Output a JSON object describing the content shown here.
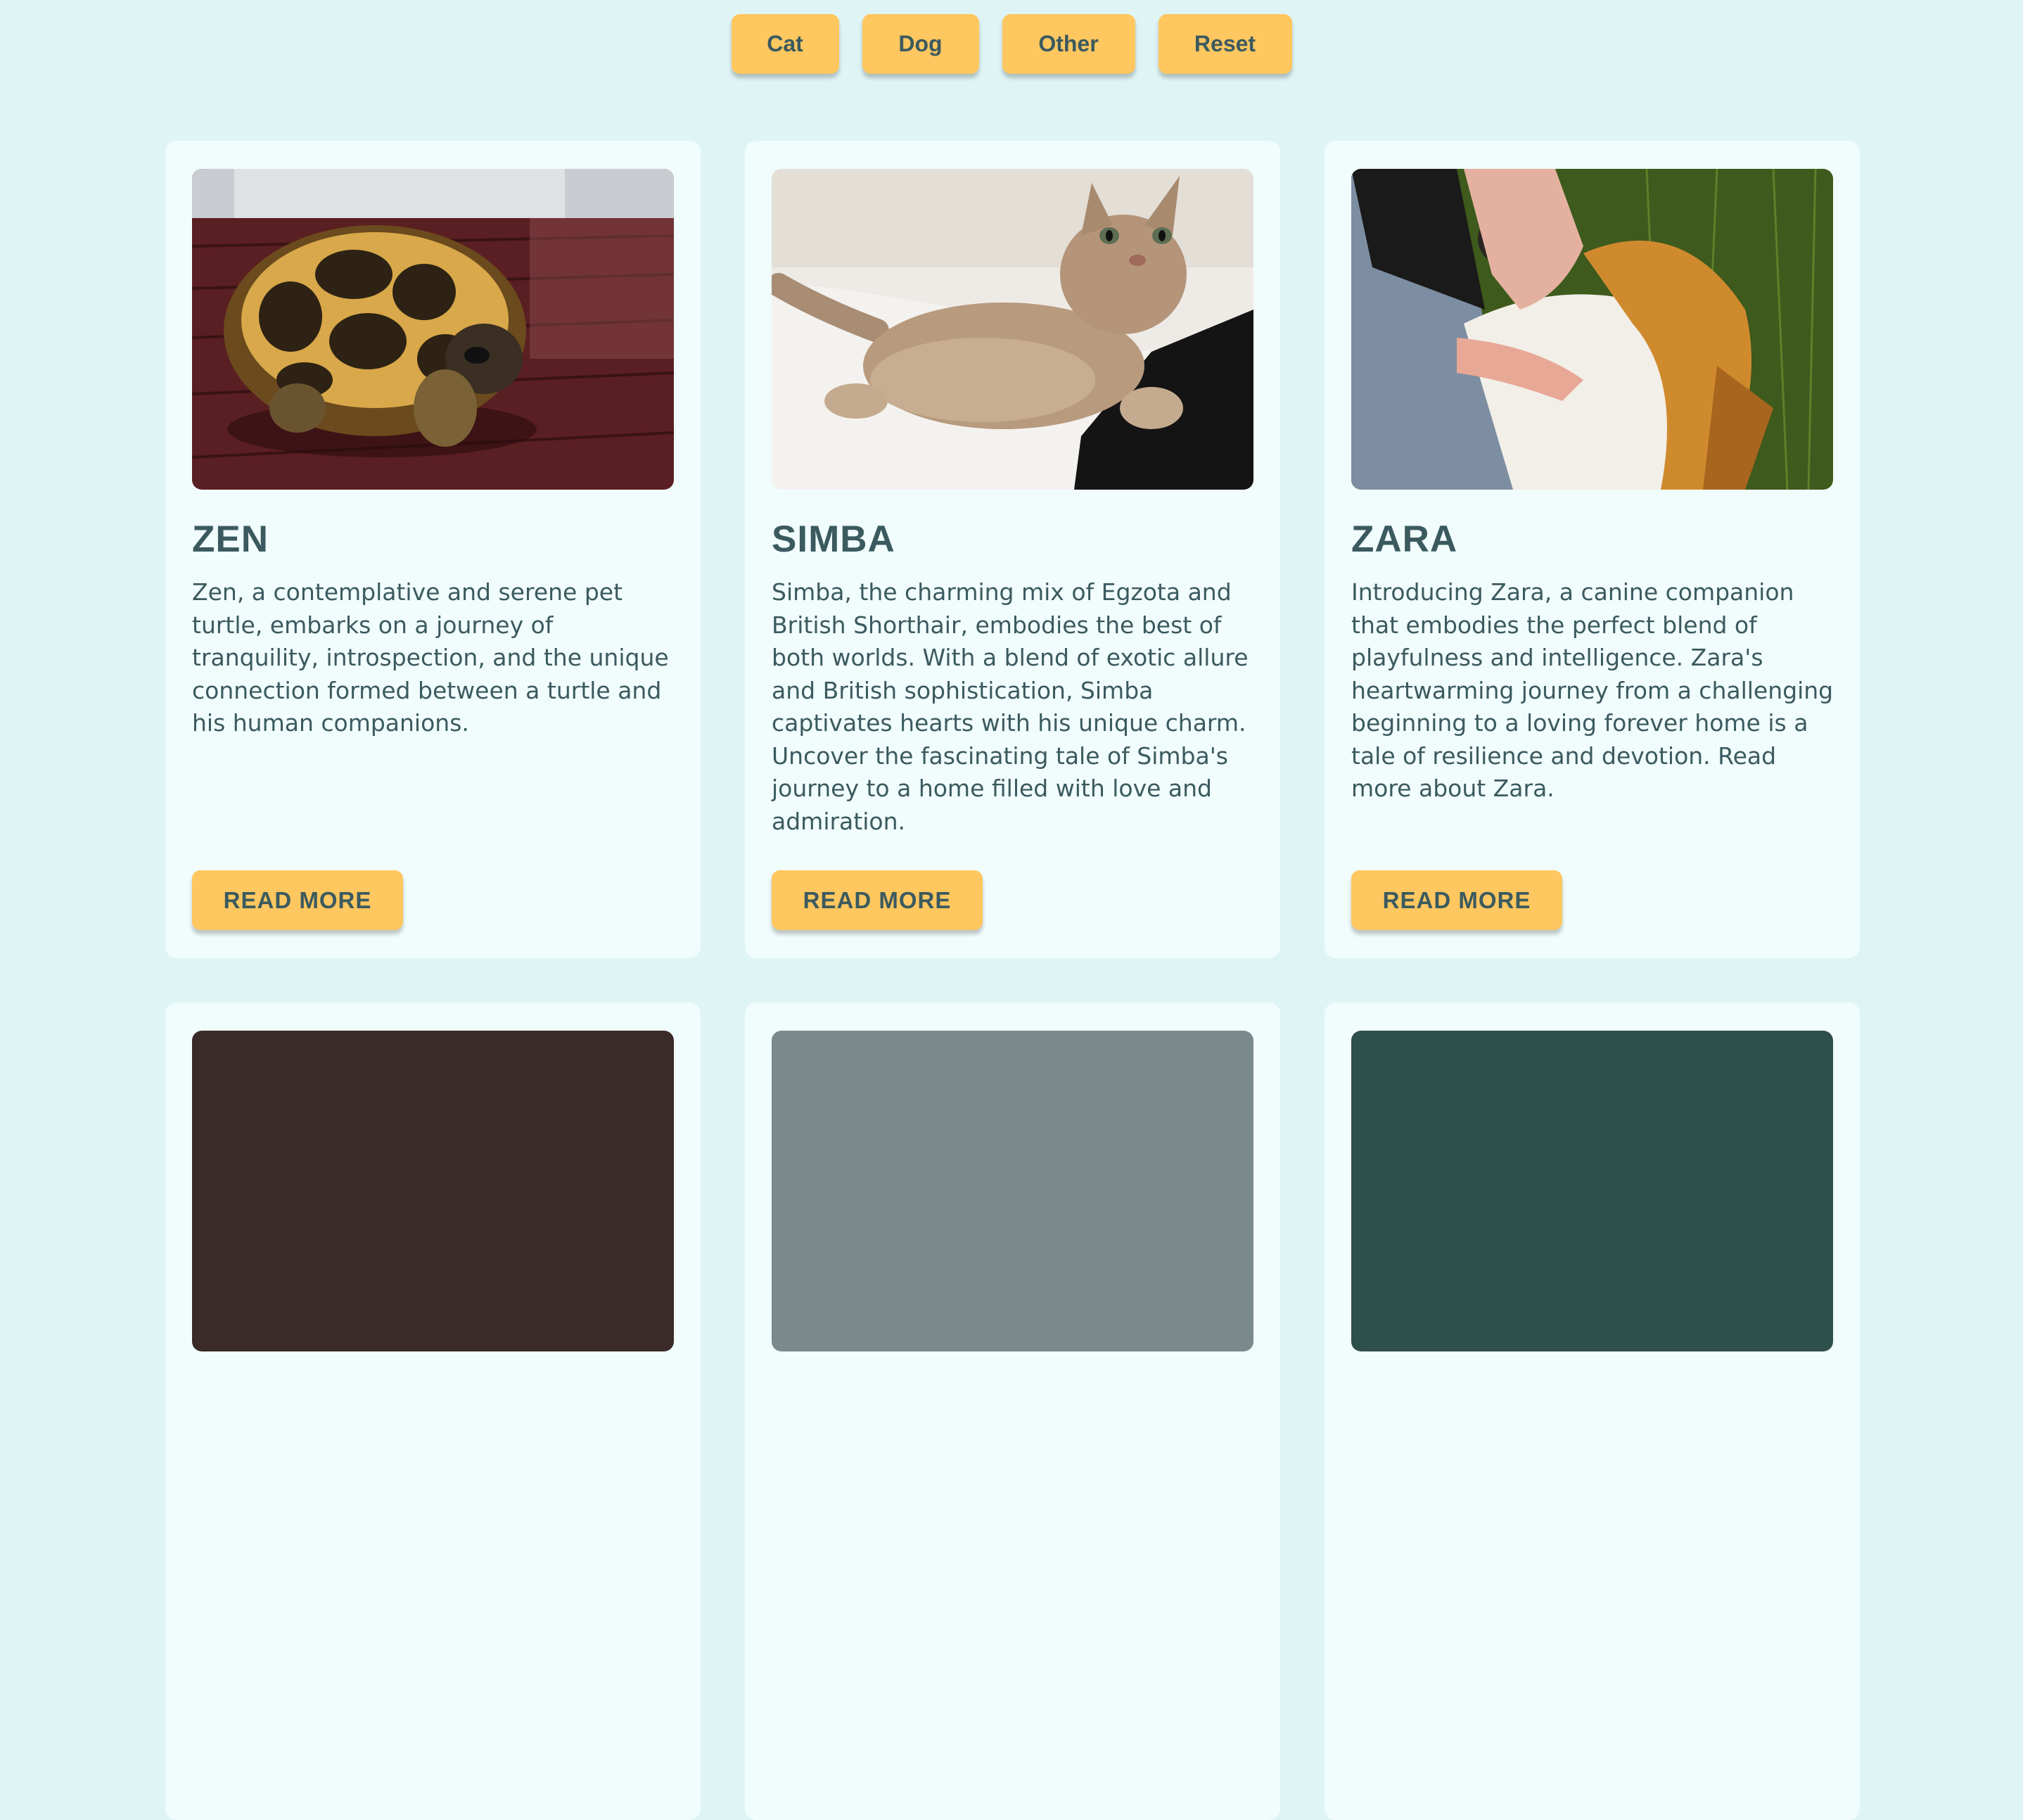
{
  "filters": {
    "cat": "Cat",
    "dog": "Dog",
    "other": "Other",
    "reset": "Reset"
  },
  "pets": [
    {
      "name": "ZEN",
      "description": "Zen, a contemplative and serene pet turtle, embarks on a journey of tranquility, introspection, and the unique connection formed between a turtle and his human companions.",
      "button": "READ MORE"
    },
    {
      "name": "SIMBA",
      "description": "Simba, the charming mix of Egzota and British Shorthair, embodies the best of both worlds. With a blend of exotic allure and British sophistication, Simba captivates hearts with his unique charm. Uncover the fascinating tale of Simba's journey to a home filled with love and admiration.",
      "button": "READ MORE"
    },
    {
      "name": "ZARA",
      "description": "Introducing Zara, a canine companion that embodies the perfect blend of playfulness and intelligence. Zara's heartwarming journey from a challenging beginning to a loving forever home is a tale of resilience and devotion. Read more about Zara.",
      "button": "READ MORE"
    }
  ],
  "colors": {
    "background": "#dff5f5",
    "card": "#f1fcfc",
    "accent": "#ffc75f",
    "text": "#3b5a5f"
  }
}
